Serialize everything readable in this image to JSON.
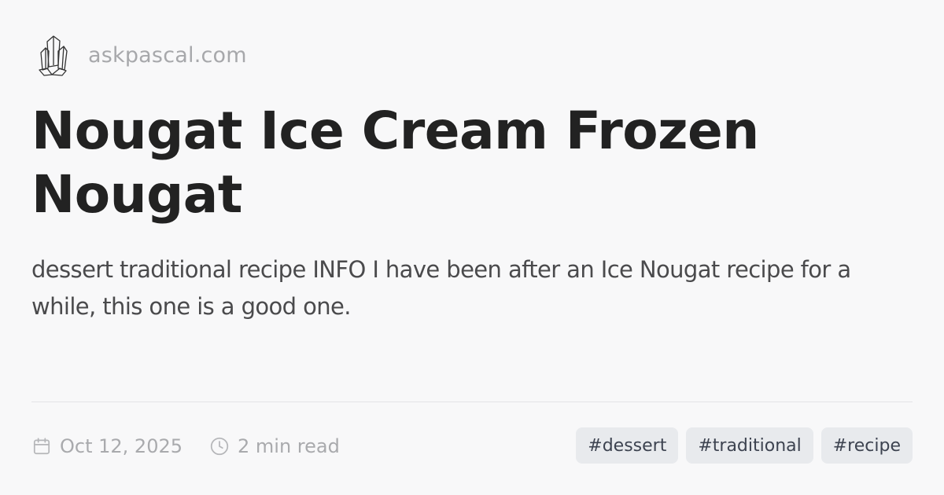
{
  "site": {
    "logo_icon": "crystal-logo-icon",
    "name": "askpascal.com"
  },
  "article": {
    "title": "Nougat Ice Cream Frozen Nougat",
    "description": "dessert traditional recipe INFO I have been after an Ice Nougat recipe for a while, this one is a good one."
  },
  "meta": {
    "date_icon": "calendar-icon",
    "date": "Oct 12, 2025",
    "read_icon": "clock-icon",
    "read_time": "2 min read"
  },
  "tags": [
    "#dessert",
    "#traditional",
    "#recipe"
  ],
  "colors": {
    "background": "#f8f8f9",
    "title": "#222222",
    "description": "#4a4a4c",
    "muted": "#a9aaad",
    "tag_background": "#e8eaed",
    "tag_text": "#3d4350"
  }
}
